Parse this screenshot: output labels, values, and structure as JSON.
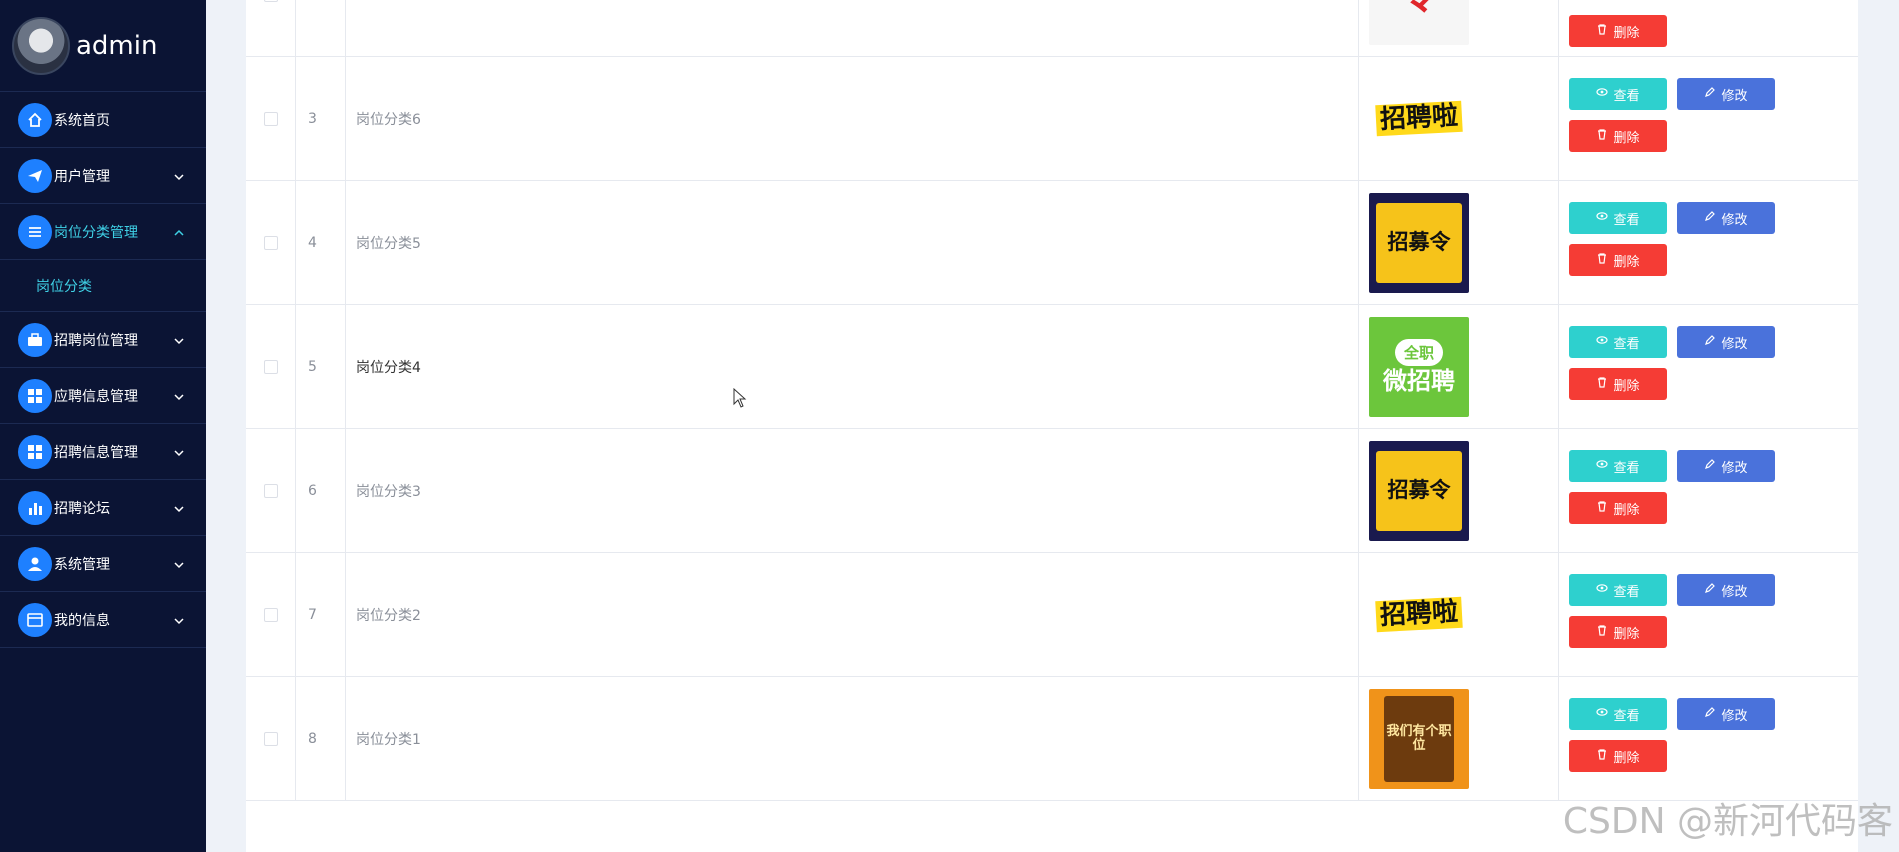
{
  "user": {
    "name": "admin"
  },
  "menu": [
    {
      "label": "系统首页",
      "icon": "home-icon",
      "chevron": ""
    },
    {
      "label": "用户管理",
      "icon": "paper-plane-icon",
      "chevron": "down"
    },
    {
      "label": "岗位分类管理",
      "icon": "list-icon",
      "chevron": "up",
      "active": true,
      "children": [
        "岗位分类"
      ]
    },
    {
      "label": "招聘岗位管理",
      "icon": "briefcase-icon",
      "chevron": "down"
    },
    {
      "label": "应聘信息管理",
      "icon": "grid-icon",
      "chevron": "down"
    },
    {
      "label": "招聘信息管理",
      "icon": "grid-icon",
      "chevron": "down"
    },
    {
      "label": "招聘论坛",
      "icon": "bar-chart-icon",
      "chevron": "down"
    },
    {
      "label": "系统管理",
      "icon": "user-icon",
      "chevron": "down"
    },
    {
      "label": "我的信息",
      "icon": "card-icon",
      "chevron": "down"
    }
  ],
  "table": {
    "rows": [
      {
        "num": "",
        "name": "",
        "thumb": "令",
        "thumb_style": "red"
      },
      {
        "num": "3",
        "name": "岗位分类6",
        "thumb": "招聘啦",
        "thumb_style": "yellow"
      },
      {
        "num": "4",
        "name": "岗位分类5",
        "thumb": "招募令",
        "thumb_style": "poster"
      },
      {
        "num": "5",
        "name": "岗位分类4",
        "thumb": "全职",
        "thumb2": "微招聘",
        "thumb_style": "green"
      },
      {
        "num": "6",
        "name": "岗位分类3",
        "thumb": "招募令",
        "thumb_style": "poster"
      },
      {
        "num": "7",
        "name": "岗位分类2",
        "thumb": "招聘啦",
        "thumb_style": "yellow"
      },
      {
        "num": "8",
        "name": "岗位分类1",
        "thumb": "我们有个职位",
        "thumb_style": "orange"
      }
    ],
    "actions": {
      "view": "查看",
      "edit": "修改",
      "delete": "删除"
    }
  },
  "watermark": "CSDN @新河代码客"
}
